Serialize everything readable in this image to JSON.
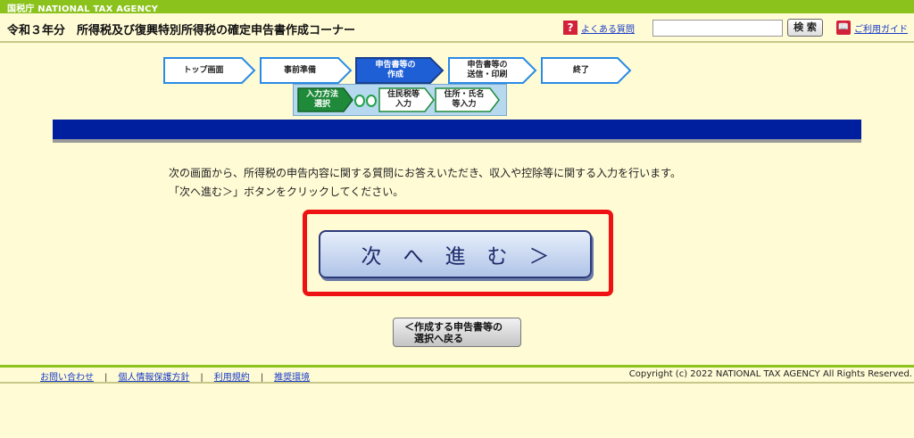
{
  "agency": "国税庁 NATIONAL TAX AGENCY",
  "header": {
    "title": "令和３年分　所得税及び復興特別所得税の確定申告書作成コーナー",
    "faq_label": "よくある質問",
    "faq_icon": "question-icon",
    "search_placeholder": "",
    "search_button": "検 索",
    "guide_label": "ご利用ガイド",
    "guide_icon": "book-icon"
  },
  "steps": [
    {
      "label": "トップ画面",
      "state": "done"
    },
    {
      "label": "事前準備",
      "state": "done"
    },
    {
      "label": "申告書等の\n作成",
      "state": "current"
    },
    {
      "label": "申告書等の\n送信・印刷",
      "state": "todo"
    },
    {
      "label": "終了",
      "state": "todo"
    }
  ],
  "substeps": [
    {
      "label": "入力方法\n選択",
      "state": "current"
    },
    {
      "label": "住民税等\n入力",
      "state": "todo"
    },
    {
      "label": "住所・氏名\n等入力",
      "state": "todo"
    }
  ],
  "instruction": {
    "line1": "次の画面から、所得税の申告内容に関する質問にお答えいただき、収入や控除等に関する入力を行います。",
    "line2": "「次へ進む＞」ボタンをクリックしてください。"
  },
  "buttons": {
    "next": "次へ進む＞",
    "back": "＜作成する申告書等の\n　選択へ戻る"
  },
  "footer": {
    "links": [
      "お問い合わせ",
      "個人情報保護方針",
      "利用規約",
      "推奨環境"
    ],
    "copyright": "Copyright (c) 2022 NATIONAL TAX AGENCY All Rights Reserved."
  },
  "colors": {
    "agency_bar": "#8bc21b",
    "step_current": "#1f5fd6",
    "substep_current": "#1e8a3a",
    "content_bar": "#001f9e",
    "highlight": "#ee1212"
  }
}
